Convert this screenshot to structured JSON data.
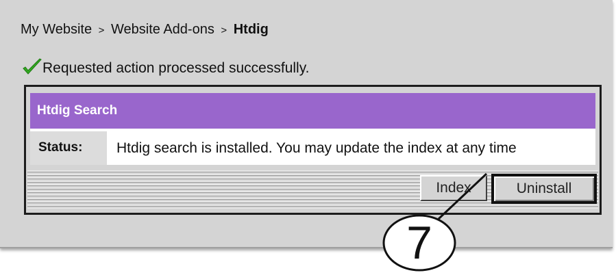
{
  "breadcrumb": {
    "item1": "My Website",
    "sep1": ">",
    "item2": "Website Add-ons",
    "sep2": ">",
    "current": "Htdig"
  },
  "message": {
    "icon": "check-icon",
    "text": "Requested action processed successfully."
  },
  "section": {
    "title": "Htdig Search",
    "header_color": "#9966cc",
    "status_label": "Status:",
    "status_value": "Htdig search is installed. You may update the index at any time"
  },
  "buttons": {
    "index_label": "Index",
    "uninstall_label": "Uninstall"
  },
  "callout": {
    "number": "7"
  }
}
